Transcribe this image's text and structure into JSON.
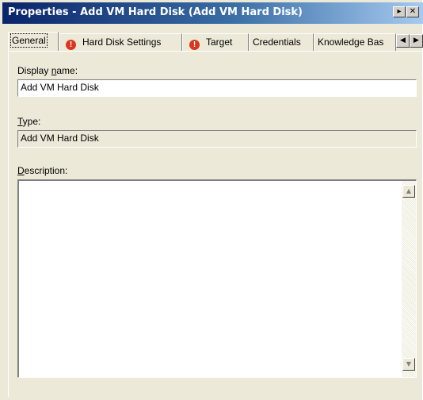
{
  "window": {
    "title": "Properties - Add VM Hard Disk (Add VM Hard Disk)",
    "min_glyph": "▸",
    "close_glyph": "✕"
  },
  "tabs": [
    {
      "label": "General",
      "warning": false,
      "active": true
    },
    {
      "label": "Hard Disk Settings",
      "warning": true,
      "active": false
    },
    {
      "label": "Target",
      "warning": true,
      "active": false
    },
    {
      "label": "Credentials",
      "warning": false,
      "active": false
    },
    {
      "label": "Knowledge Bas",
      "warning": false,
      "active": false
    }
  ],
  "tab_scroll": {
    "left_glyph": "◀",
    "right_glyph": "▶"
  },
  "warning_glyph": "!",
  "form": {
    "display_name_label_pre": "Display ",
    "display_name_label_mnemonic": "n",
    "display_name_label_post": "ame:",
    "display_name_value": "Add VM Hard Disk",
    "type_label_mnemonic": "T",
    "type_label_post": "ype:",
    "type_value": "Add VM Hard Disk",
    "description_label_mnemonic": "D",
    "description_label_post": "escription:",
    "description_value": ""
  },
  "scroll": {
    "up_glyph": "▲",
    "down_glyph": "▼"
  },
  "colors": {
    "title_start": "#0a246a",
    "title_end": "#a6caf0",
    "warning": "#d9371e",
    "face": "#ece9d8"
  }
}
